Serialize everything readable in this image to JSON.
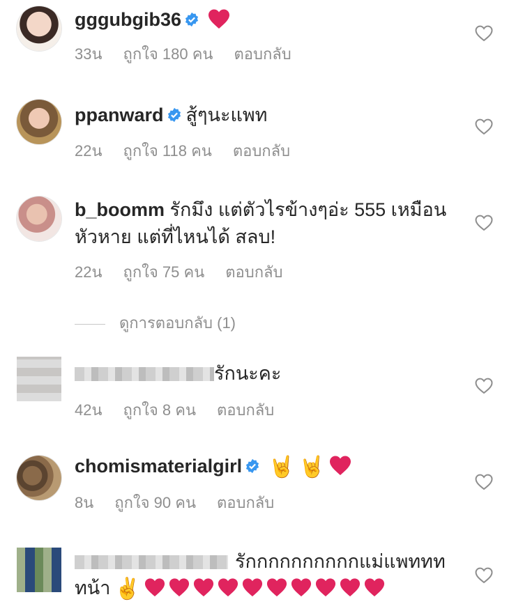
{
  "comments": [
    {
      "username": "gggubgib36",
      "verified": true,
      "text": "",
      "emojis": [
        "heart"
      ],
      "time": "33น",
      "likes": "ถูกใจ 180 คน",
      "reply": "ตอบกลับ"
    },
    {
      "username": "ppanward",
      "verified": true,
      "text": "สู้ๆนะแพท",
      "time": "22น",
      "likes": "ถูกใจ 118 คน",
      "reply": "ตอบกลับ"
    },
    {
      "username": "b_boomm",
      "verified": false,
      "text_line1": "รักมึง แต่ตัวไรข้างๆอ่ะ 555 เหมือน",
      "text_line2": "หัวหาย แต่ที่ไหนได้ สลบ!",
      "time": "22น",
      "likes": "ถูกใจ 75 คน",
      "reply": "ตอบกลับ",
      "view_replies": "ดูการตอบกลับ (1)"
    },
    {
      "username_censored": true,
      "text": "รักนะคะ",
      "time": "42น",
      "likes": "ถูกใจ 8 คน",
      "reply": "ตอบกลับ"
    },
    {
      "username": "chomismaterialgirl",
      "verified": true,
      "emojis": [
        "sign-of-horns",
        "sign-of-horns",
        "heart"
      ],
      "time": "8น",
      "likes": "ถูกใจ 90 คน",
      "reply": "ตอบกลับ"
    },
    {
      "username_censored": true,
      "text_line1": "รักกกกกกกกกกแม่แพททท",
      "text_line2": "ทน้า",
      "emojis": [
        "victory-hand",
        "heart",
        "heart",
        "heart",
        "heart",
        "heart",
        "heart",
        "heart",
        "heart",
        "heart",
        "heart"
      ]
    }
  ],
  "colors": {
    "text": "#262626",
    "meta": "#8e8e8e",
    "verified": "#3897f0",
    "heart_emoji": "#e0245e"
  }
}
